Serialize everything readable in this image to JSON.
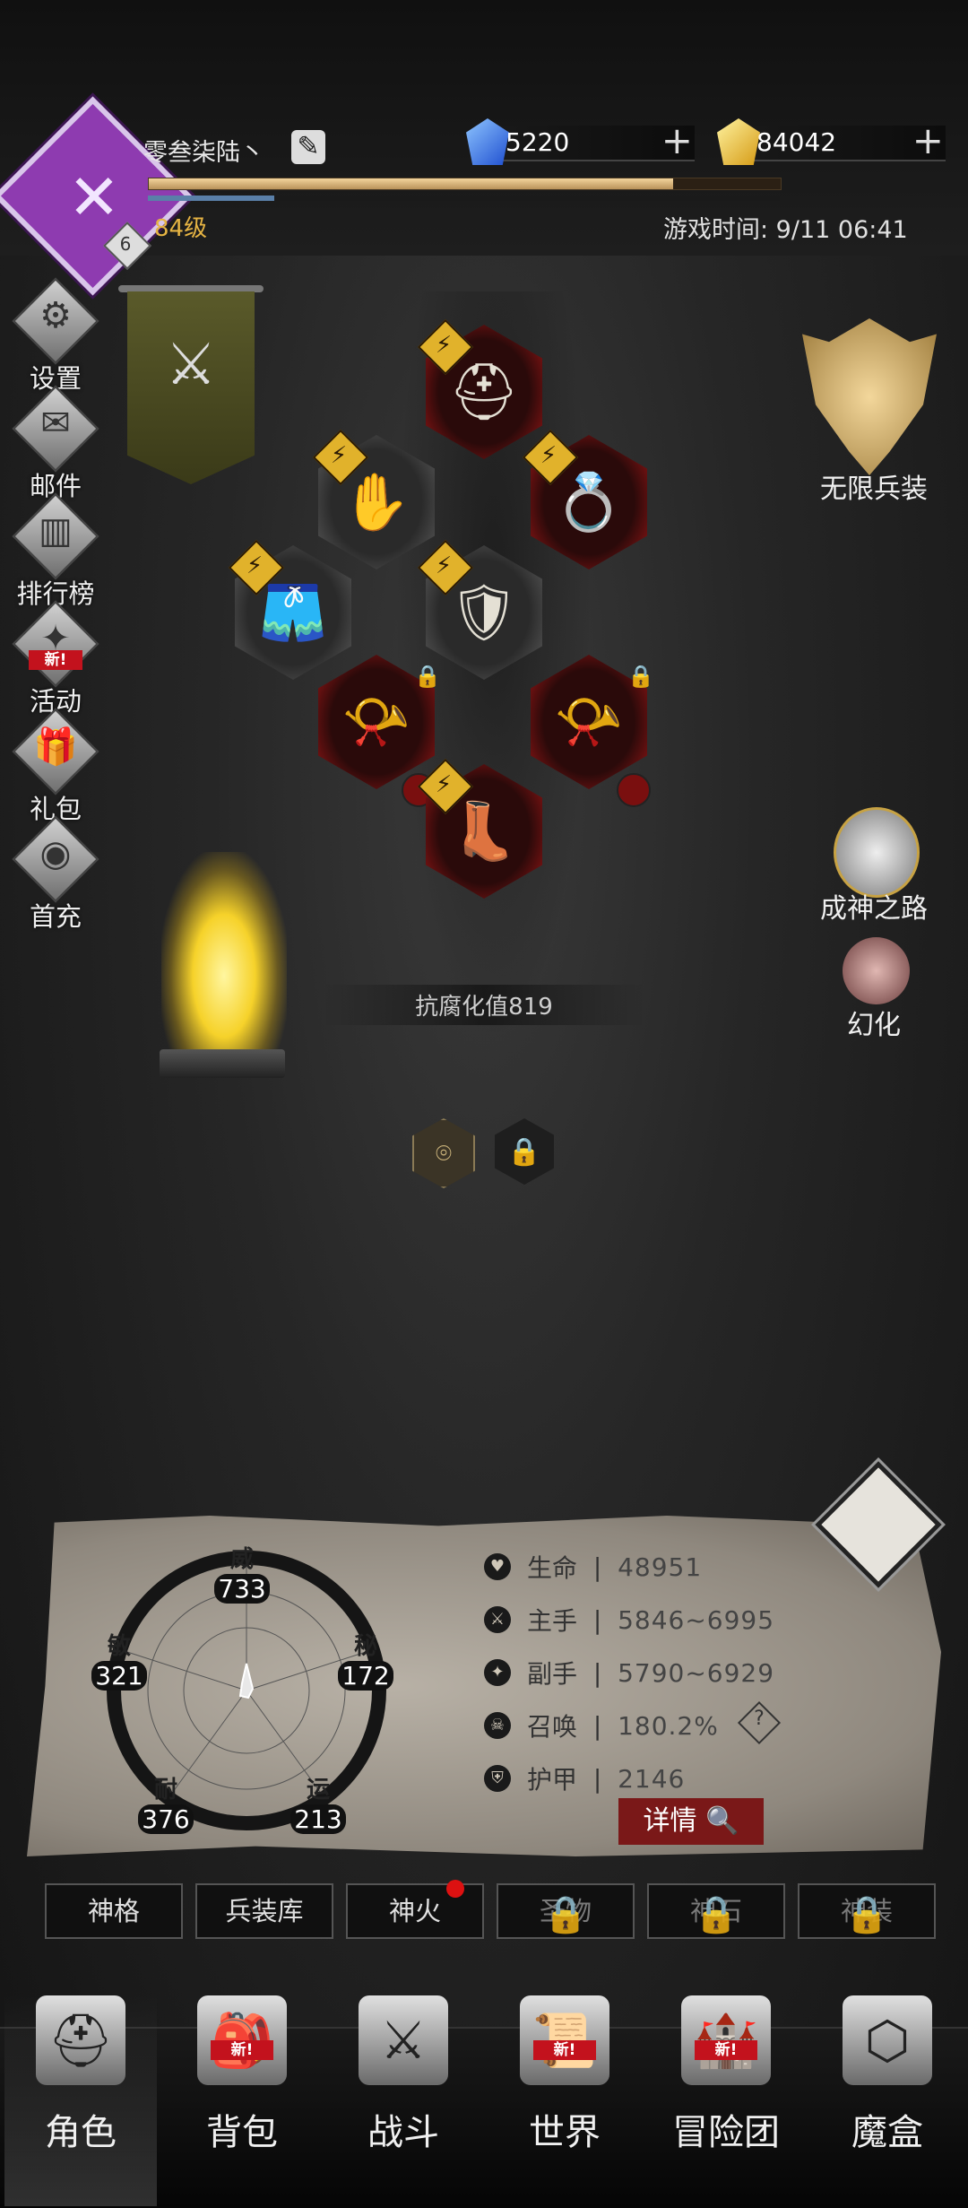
{
  "player": {
    "name": "零叁柒陆丶",
    "level_text": "84级",
    "avatar_level": "6",
    "exp_ratio": 0.83,
    "exp2_ratio": 0.2
  },
  "currency": {
    "gem": "5220",
    "gold": "84042",
    "plus": "+"
  },
  "game_time": "游戏时间: 9/11 06:41",
  "left_menu": [
    {
      "label": "设置",
      "icon": "gear-icon"
    },
    {
      "label": "邮件",
      "icon": "envelope-icon"
    },
    {
      "label": "排行榜",
      "icon": "leaderboard-icon"
    },
    {
      "label": "活动",
      "icon": "event-icon",
      "new": "新!"
    },
    {
      "label": "礼包",
      "icon": "gift-icon"
    },
    {
      "label": "首充",
      "icon": "first-charge-icon"
    }
  ],
  "right_menu": {
    "infinite_gear": "无限兵装",
    "path_to_god": "成神之路",
    "illusion": "幻化"
  },
  "equipment": {
    "helmet": "⛑",
    "gauntlet": "✋",
    "ring": "💍",
    "belt": "🩳",
    "armor": "🛡",
    "horn_left": "📯",
    "horn_right": "📯",
    "boots": "👢",
    "bolt": "⚡",
    "lock": "🔒"
  },
  "corrosion_text": "抗腐化值819",
  "attributes": {
    "wei": {
      "name": "威",
      "value": "733"
    },
    "mi": {
      "name": "秘",
      "value": "172"
    },
    "yun": {
      "name": "运",
      "value": "213"
    },
    "nai": {
      "name": "耐",
      "value": "376"
    },
    "min": {
      "name": "敏",
      "value": "321"
    }
  },
  "stats": [
    {
      "label": "生命",
      "value": "48951",
      "icon": "heart-icon"
    },
    {
      "label": "主手",
      "value": "5846~6995",
      "icon": "main-hand-icon"
    },
    {
      "label": "副手",
      "value": "5790~6929",
      "icon": "off-hand-icon"
    },
    {
      "label": "召唤",
      "value": "180.2%",
      "icon": "summon-icon"
    },
    {
      "label": "护甲",
      "value": "2146",
      "icon": "armor-icon"
    }
  ],
  "stat_separator": "|",
  "question_mark": "?",
  "detail_button": "详情",
  "tabs": [
    {
      "label": "神格",
      "locked": false
    },
    {
      "label": "兵装库",
      "locked": false
    },
    {
      "label": "神火",
      "locked": false,
      "dot": true
    },
    {
      "label": "圣物",
      "locked": true
    },
    {
      "label": "神石",
      "locked": true
    },
    {
      "label": "神装",
      "locked": true
    }
  ],
  "bottom_nav": [
    {
      "label": "角色",
      "icon": "helmet-icon",
      "active": true
    },
    {
      "label": "背包",
      "icon": "backpack-icon",
      "new": "新!"
    },
    {
      "label": "战斗",
      "icon": "sword-shield-icon"
    },
    {
      "label": "世界",
      "icon": "scroll-map-icon",
      "new": "新!"
    },
    {
      "label": "冒险团",
      "icon": "castle-icon",
      "new": "新!"
    },
    {
      "label": "魔盒",
      "icon": "magic-box-icon"
    }
  ],
  "colors": {
    "accent_red": "#7a1818",
    "gold": "#e6b443",
    "purple": "#8e3bb0"
  }
}
